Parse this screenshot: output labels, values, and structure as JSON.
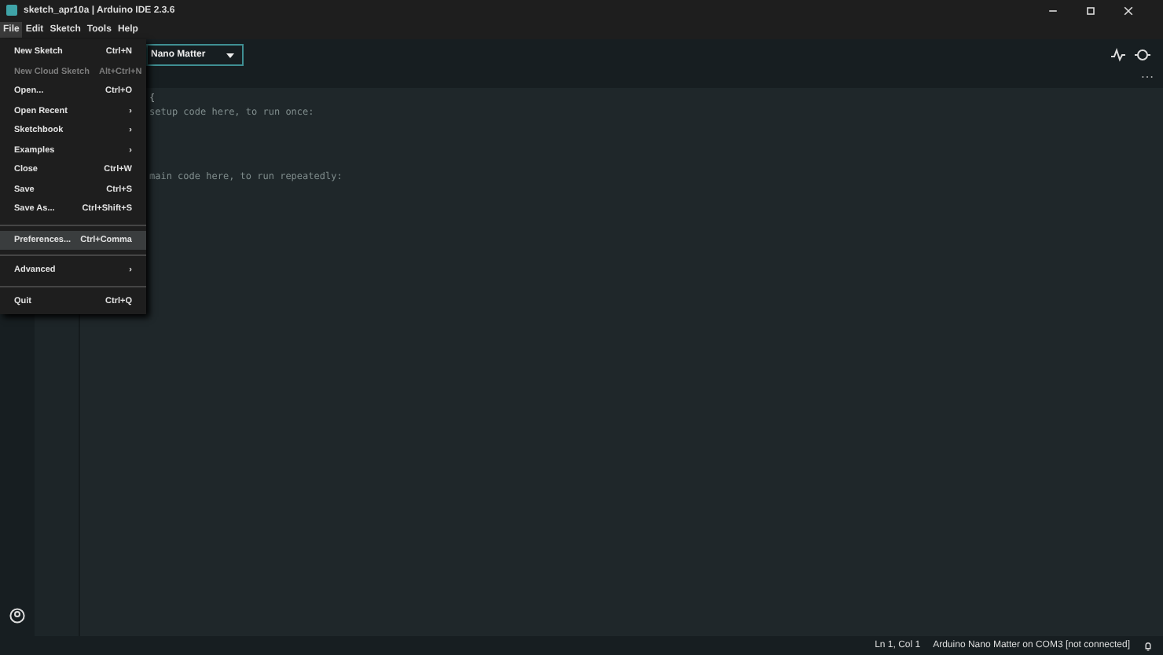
{
  "window": {
    "title": "sketch_apr10a | Arduino IDE 2.3.6"
  },
  "menubar": [
    {
      "label": "File",
      "selected": true
    },
    {
      "label": "Edit",
      "selected": false
    },
    {
      "label": "Sketch",
      "selected": false
    },
    {
      "label": "Tools",
      "selected": false
    },
    {
      "label": "Help",
      "selected": false
    }
  ],
  "board_selector": {
    "value": "Nano Matter"
  },
  "file_menu": [
    {
      "kind": "item",
      "label": "New Sketch",
      "shortcut": "Ctrl+N",
      "disabled": false,
      "selected": false
    },
    {
      "kind": "item",
      "label": "New Cloud Sketch",
      "shortcut": "Alt+Ctrl+N",
      "disabled": true,
      "selected": false
    },
    {
      "kind": "item",
      "label": "Open...",
      "shortcut": "Ctrl+O",
      "disabled": false,
      "selected": false
    },
    {
      "kind": "item",
      "label": "Open Recent",
      "shortcut": "›",
      "disabled": false,
      "selected": false
    },
    {
      "kind": "item",
      "label": "Sketchbook",
      "shortcut": "›",
      "disabled": false,
      "selected": false
    },
    {
      "kind": "item",
      "label": "Examples",
      "shortcut": "›",
      "disabled": false,
      "selected": false
    },
    {
      "kind": "item",
      "label": "Close",
      "shortcut": "Ctrl+W",
      "disabled": false,
      "selected": false
    },
    {
      "kind": "item",
      "label": "Save",
      "shortcut": "Ctrl+S",
      "disabled": false,
      "selected": false
    },
    {
      "kind": "item",
      "label": "Save As...",
      "shortcut": "Ctrl+Shift+S",
      "disabled": false,
      "selected": false
    },
    {
      "kind": "separator"
    },
    {
      "kind": "item",
      "label": "Preferences...",
      "shortcut": "Ctrl+Comma",
      "disabled": false,
      "selected": true
    },
    {
      "kind": "separator"
    },
    {
      "kind": "item",
      "label": "Advanced",
      "shortcut": "›",
      "disabled": false,
      "selected": false
    },
    {
      "kind": "separator"
    },
    {
      "kind": "item",
      "label": "Quit",
      "shortcut": "Ctrl+Q",
      "disabled": false,
      "selected": false
    }
  ],
  "editor": {
    "lines": [
      {
        "text": "{"
      },
      {
        "text": "setup code here, to run once:"
      },
      {
        "text": "main code here, to run repeatedly:"
      }
    ]
  },
  "status_bar": {
    "position": "Ln 1, Col 1",
    "board": "Arduino Nano Matter on COM3 [not connected]"
  }
}
